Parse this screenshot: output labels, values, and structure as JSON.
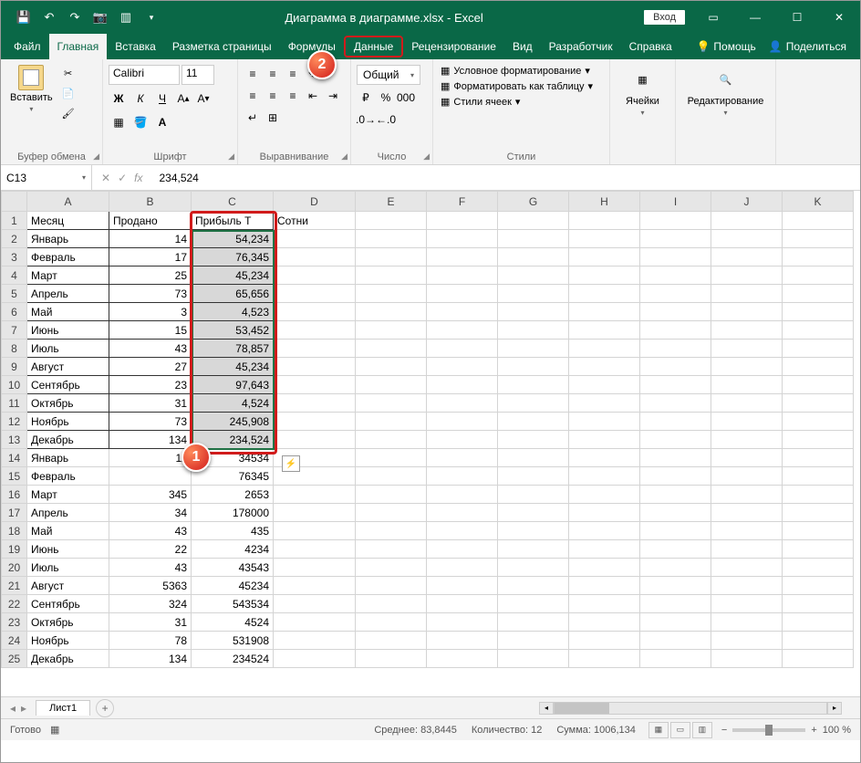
{
  "title": "Диаграмма в диаграмме.xlsx - Excel",
  "login": "Вход",
  "tabs": {
    "file": "Файл",
    "home": "Главная",
    "insert": "Вставка",
    "layout": "Разметка страницы",
    "formulas": "Формулы",
    "data": "Данные",
    "review": "Рецензирование",
    "view": "Вид",
    "developer": "Разработчик",
    "help": "Справка",
    "tellme": "Помощь",
    "share": "Поделиться"
  },
  "ribbon": {
    "clipboard": {
      "label": "Буфер обмена",
      "paste": "Вставить"
    },
    "font": {
      "label": "Шрифт",
      "name": "Calibri",
      "size": "11"
    },
    "alignment": {
      "label": "Выравнивание"
    },
    "number": {
      "label": "Число",
      "format": "Общий"
    },
    "styles": {
      "label": "Стили",
      "conditional": "Условное форматирование",
      "table": "Форматировать как таблицу",
      "cell": "Стили ячеек"
    },
    "cells": {
      "label": "Ячейки"
    },
    "editing": {
      "label": "Редактирование"
    }
  },
  "name_box": "C13",
  "formula": "234,524",
  "columns": [
    "A",
    "B",
    "C",
    "D",
    "E",
    "F",
    "G",
    "H",
    "I",
    "J",
    "K"
  ],
  "headers": {
    "A": "Месяц",
    "B": "Продано",
    "C": "Прибыль Т",
    "D": "Сотни"
  },
  "rows": [
    {
      "n": 1,
      "A": "Месяц",
      "B": "Продано",
      "C": "Прибыль Т",
      "D": "Сотни",
      "hdr": true
    },
    {
      "n": 2,
      "A": "Январь",
      "B": "14",
      "C": "54,234",
      "sel": true
    },
    {
      "n": 3,
      "A": "Февраль",
      "B": "17",
      "C": "76,345",
      "sel": true
    },
    {
      "n": 4,
      "A": "Март",
      "B": "25",
      "C": "45,234",
      "sel": true
    },
    {
      "n": 5,
      "A": "Апрель",
      "B": "73",
      "C": "65,656",
      "sel": true
    },
    {
      "n": 6,
      "A": "Май",
      "B": "3",
      "C": "4,523",
      "sel": true
    },
    {
      "n": 7,
      "A": "Июнь",
      "B": "15",
      "C": "53,452",
      "sel": true
    },
    {
      "n": 8,
      "A": "Июль",
      "B": "43",
      "C": "78,857",
      "sel": true
    },
    {
      "n": 9,
      "A": "Август",
      "B": "27",
      "C": "45,234",
      "sel": true
    },
    {
      "n": 10,
      "A": "Сентябрь",
      "B": "23",
      "C": "97,643",
      "sel": true
    },
    {
      "n": 11,
      "A": "Октябрь",
      "B": "31",
      "C": "4,524",
      "sel": true
    },
    {
      "n": 12,
      "A": "Ноябрь",
      "B": "73",
      "C": "245,908",
      "sel": true
    },
    {
      "n": 13,
      "A": "Декабрь",
      "B": "134",
      "C": "234,524",
      "sel": true,
      "active": true
    },
    {
      "n": 14,
      "A": "Январь",
      "B": "11",
      "C": "34534"
    },
    {
      "n": 15,
      "A": "Февраль",
      "B": "",
      "C": "76345"
    },
    {
      "n": 16,
      "A": "Март",
      "B": "345",
      "C": "2653"
    },
    {
      "n": 17,
      "A": "Апрель",
      "B": "34",
      "C": "178000"
    },
    {
      "n": 18,
      "A": "Май",
      "B": "43",
      "C": "435"
    },
    {
      "n": 19,
      "A": "Июнь",
      "B": "22",
      "C": "4234"
    },
    {
      "n": 20,
      "A": "Июль",
      "B": "43",
      "C": "43543"
    },
    {
      "n": 21,
      "A": "Август",
      "B": "5363",
      "C": "45234"
    },
    {
      "n": 22,
      "A": "Сентябрь",
      "B": "324",
      "C": "543534"
    },
    {
      "n": 23,
      "A": "Октябрь",
      "B": "31",
      "C": "4524"
    },
    {
      "n": 24,
      "A": "Ноябрь",
      "B": "78",
      "C": "531908"
    },
    {
      "n": 25,
      "A": "Декабрь",
      "B": "134",
      "C": "234524"
    }
  ],
  "sheet_tab": "Лист1",
  "status": {
    "ready": "Готово",
    "avg_label": "Среднее:",
    "avg": "83,8445",
    "count_label": "Количество:",
    "count": "12",
    "sum_label": "Сумма:",
    "sum": "1006,134",
    "zoom": "100 %"
  },
  "badges": {
    "one": "1",
    "two": "2"
  }
}
